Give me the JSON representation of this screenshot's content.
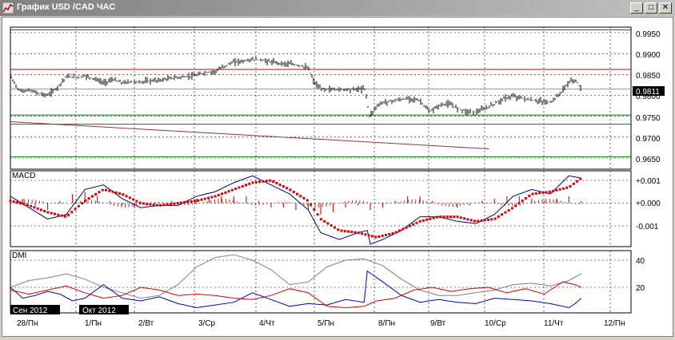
{
  "window": {
    "title": "График USD /CAD  ЧАС",
    "btn_minimize": "_",
    "btn_maximize": "□",
    "btn_close": "✕"
  },
  "colors": {
    "price_bars": "#000000",
    "resistance_red": "#cc0000",
    "support_green": "#008000",
    "trend_line": "#993333",
    "macd_line": "#000080",
    "macd_signal": "#dd0000",
    "histogram": "#cc2222",
    "dmi_adx": "#808080",
    "dmi_plus": "#0000cc",
    "dmi_minus": "#dd0000",
    "price_tag_bg": "#000000"
  },
  "icons": {
    "title": "chart-app-icon"
  },
  "price_panel": {
    "y_ticks": [
      "0.9950",
      "0.9900",
      "0.9850",
      "0.9800",
      "0.9750",
      "0.9700",
      "0.9650"
    ],
    "current_price": "0.9811",
    "hlines_red": [
      0.9957,
      0.9862
    ],
    "hline_pink": 0.9815,
    "hlines_green": [
      0.9753,
      0.9731,
      0.9653
    ],
    "trend_line": [
      [
        0.9737,
        0
      ],
      [
        0.9672,
        0.771
      ]
    ],
    "series_points": [
      [
        0,
        0.9845
      ],
      [
        0.015,
        0.981
      ],
      [
        0.03,
        0.9812
      ],
      [
        0.045,
        0.9805
      ],
      [
        0.06,
        0.98
      ],
      [
        0.075,
        0.9818
      ],
      [
        0.09,
        0.9845
      ],
      [
        0.105,
        0.9843
      ],
      [
        0.12,
        0.9847
      ],
      [
        0.135,
        0.984
      ],
      [
        0.15,
        0.983
      ],
      [
        0.165,
        0.9838
      ],
      [
        0.18,
        0.983
      ],
      [
        0.195,
        0.9833
      ],
      [
        0.21,
        0.9832
      ],
      [
        0.225,
        0.9835
      ],
      [
        0.24,
        0.9836
      ],
      [
        0.255,
        0.984
      ],
      [
        0.27,
        0.9843
      ],
      [
        0.285,
        0.9845
      ],
      [
        0.3,
        0.9848
      ],
      [
        0.315,
        0.9855
      ],
      [
        0.33,
        0.9857
      ],
      [
        0.345,
        0.987
      ],
      [
        0.36,
        0.988
      ],
      [
        0.375,
        0.9882
      ],
      [
        0.39,
        0.9886
      ],
      [
        0.405,
        0.9885
      ],
      [
        0.42,
        0.988
      ],
      [
        0.435,
        0.9877
      ],
      [
        0.45,
        0.9875
      ],
      [
        0.465,
        0.9872
      ],
      [
        0.48,
        0.9865
      ],
      [
        0.49,
        0.983
      ],
      [
        0.5,
        0.9815
      ],
      [
        0.515,
        0.9815
      ],
      [
        0.53,
        0.9814
      ],
      [
        0.545,
        0.9815
      ],
      [
        0.56,
        0.9815
      ],
      [
        0.572,
        0.9816
      ],
      [
        0.578,
        0.975
      ],
      [
        0.59,
        0.9774
      ],
      [
        0.6,
        0.9783
      ],
      [
        0.615,
        0.9787
      ],
      [
        0.63,
        0.979
      ],
      [
        0.645,
        0.9793
      ],
      [
        0.66,
        0.9787
      ],
      [
        0.675,
        0.976
      ],
      [
        0.69,
        0.9775
      ],
      [
        0.705,
        0.978
      ],
      [
        0.72,
        0.977
      ],
      [
        0.735,
        0.9762
      ],
      [
        0.75,
        0.976
      ],
      [
        0.765,
        0.9768
      ],
      [
        0.78,
        0.978
      ],
      [
        0.795,
        0.9792
      ],
      [
        0.81,
        0.9798
      ],
      [
        0.825,
        0.9793
      ],
      [
        0.84,
        0.9788
      ],
      [
        0.855,
        0.9786
      ],
      [
        0.87,
        0.9783
      ],
      [
        0.885,
        0.9803
      ],
      [
        0.9,
        0.9832
      ],
      [
        0.91,
        0.9837
      ],
      [
        0.92,
        0.9815
      ]
    ]
  },
  "macd_panel": {
    "label": "MACD",
    "y_ticks": [
      "+0.001",
      "+0.000",
      "-0.001"
    ],
    "macd_line": [
      [
        0,
        0.0003
      ],
      [
        0.03,
        -0.0002
      ],
      [
        0.06,
        -0.0007
      ],
      [
        0.09,
        -0.0005
      ],
      [
        0.12,
        0.0006
      ],
      [
        0.15,
        0.0008
      ],
      [
        0.18,
        0.0002
      ],
      [
        0.21,
        -0.0002
      ],
      [
        0.24,
        -0.0001
      ],
      [
        0.27,
        -0.0001
      ],
      [
        0.3,
        0.0003
      ],
      [
        0.33,
        0.0005
      ],
      [
        0.36,
        0.0009
      ],
      [
        0.39,
        0.0012
      ],
      [
        0.42,
        0.0008
      ],
      [
        0.45,
        0.0004
      ],
      [
        0.48,
        -0.0003
      ],
      [
        0.5,
        -0.0013
      ],
      [
        0.53,
        -0.0016
      ],
      [
        0.56,
        -0.0013
      ],
      [
        0.575,
        -0.0012
      ],
      [
        0.58,
        -0.0018
      ],
      [
        0.6,
        -0.0016
      ],
      [
        0.63,
        -0.0012
      ],
      [
        0.66,
        -0.0006
      ],
      [
        0.69,
        -0.0006
      ],
      [
        0.72,
        -0.0008
      ],
      [
        0.75,
        -0.0009
      ],
      [
        0.78,
        -0.0005
      ],
      [
        0.81,
        0.0003
      ],
      [
        0.84,
        0.0006
      ],
      [
        0.87,
        0.0004
      ],
      [
        0.9,
        0.0012
      ],
      [
        0.92,
        0.0011
      ]
    ],
    "signal_line": [
      [
        0,
        0.0001
      ],
      [
        0.03,
        -0.0001
      ],
      [
        0.06,
        -0.0004
      ],
      [
        0.09,
        -0.0006
      ],
      [
        0.12,
        0.0001
      ],
      [
        0.15,
        0.0006
      ],
      [
        0.18,
        0.0004
      ],
      [
        0.21,
        0.0
      ],
      [
        0.24,
        -0.0001
      ],
      [
        0.27,
        0.0
      ],
      [
        0.3,
        0.0001
      ],
      [
        0.33,
        0.0003
      ],
      [
        0.36,
        0.0006
      ],
      [
        0.39,
        0.0009
      ],
      [
        0.42,
        0.001
      ],
      [
        0.45,
        0.0006
      ],
      [
        0.48,
        0.0001
      ],
      [
        0.5,
        -0.0007
      ],
      [
        0.53,
        -0.0012
      ],
      [
        0.56,
        -0.0013
      ],
      [
        0.59,
        -0.0015
      ],
      [
        0.62,
        -0.0013
      ],
      [
        0.66,
        -0.0008
      ],
      [
        0.69,
        -0.0006
      ],
      [
        0.72,
        -0.0006
      ],
      [
        0.75,
        -0.0008
      ],
      [
        0.78,
        -0.0007
      ],
      [
        0.81,
        -0.0002
      ],
      [
        0.84,
        0.0004
      ],
      [
        0.87,
        0.0005
      ],
      [
        0.9,
        0.0007
      ],
      [
        0.92,
        0.0011
      ]
    ],
    "histogram": [
      [
        0.02,
        0.0002
      ],
      [
        0.04,
        -0.0001
      ],
      [
        0.06,
        -0.0003
      ],
      [
        0.08,
        0.0001
      ],
      [
        0.1,
        0.0004
      ],
      [
        0.12,
        0.0005
      ],
      [
        0.14,
        0.0003
      ],
      [
        0.16,
        0.0001
      ],
      [
        0.18,
        -0.0001
      ],
      [
        0.2,
        -0.0002
      ],
      [
        0.22,
        -0.0001
      ],
      [
        0.24,
        0.0
      ],
      [
        0.26,
        0.0001
      ],
      [
        0.28,
        0.0001
      ],
      [
        0.3,
        0.0002
      ],
      [
        0.32,
        0.0002
      ],
      [
        0.34,
        0.0003
      ],
      [
        0.36,
        0.0003
      ],
      [
        0.38,
        0.0003
      ],
      [
        0.4,
        0.0001
      ],
      [
        0.42,
        -0.0002
      ],
      [
        0.44,
        -0.0002
      ],
      [
        0.46,
        -0.0003
      ],
      [
        0.48,
        -0.0003
      ],
      [
        0.5,
        -0.0005
      ],
      [
        0.52,
        -0.0004
      ],
      [
        0.54,
        -0.0002
      ],
      [
        0.56,
        -0.0001
      ],
      [
        0.58,
        -0.0003
      ],
      [
        0.6,
        -0.0002
      ],
      [
        0.62,
        0.0001
      ],
      [
        0.64,
        0.0003
      ],
      [
        0.66,
        0.0003
      ],
      [
        0.68,
        0.0001
      ],
      [
        0.7,
        0.0
      ],
      [
        0.72,
        -0.0002
      ],
      [
        0.74,
        -0.0001
      ],
      [
        0.76,
        0.0001
      ],
      [
        0.78,
        0.0002
      ],
      [
        0.8,
        0.0003
      ],
      [
        0.82,
        0.0003
      ],
      [
        0.84,
        0.0002
      ],
      [
        0.86,
        0.0001
      ],
      [
        0.88,
        0.0002
      ],
      [
        0.9,
        0.0003
      ],
      [
        0.92,
        0.0001
      ]
    ]
  },
  "dmi_panel": {
    "label": "DMI",
    "y_ticks": [
      "40",
      "20"
    ],
    "adx": [
      [
        0,
        20
      ],
      [
        0.03,
        25
      ],
      [
        0.06,
        27
      ],
      [
        0.09,
        30
      ],
      [
        0.12,
        26
      ],
      [
        0.15,
        20
      ],
      [
        0.18,
        16
      ],
      [
        0.21,
        12
      ],
      [
        0.24,
        14
      ],
      [
        0.27,
        22
      ],
      [
        0.3,
        35
      ],
      [
        0.33,
        42
      ],
      [
        0.36,
        44
      ],
      [
        0.39,
        40
      ],
      [
        0.42,
        33
      ],
      [
        0.45,
        22
      ],
      [
        0.48,
        24
      ],
      [
        0.51,
        35
      ],
      [
        0.54,
        40
      ],
      [
        0.57,
        41
      ],
      [
        0.6,
        36
      ],
      [
        0.63,
        26
      ],
      [
        0.66,
        18
      ],
      [
        0.69,
        14
      ],
      [
        0.72,
        14
      ],
      [
        0.75,
        16
      ],
      [
        0.78,
        18
      ],
      [
        0.81,
        22
      ],
      [
        0.84,
        23
      ],
      [
        0.87,
        21
      ],
      [
        0.9,
        25
      ],
      [
        0.92,
        30
      ]
    ],
    "plus_di": [
      [
        0,
        20
      ],
      [
        0.02,
        12
      ],
      [
        0.04,
        14
      ],
      [
        0.06,
        17
      ],
      [
        0.08,
        15
      ],
      [
        0.1,
        10
      ],
      [
        0.12,
        12
      ],
      [
        0.15,
        22
      ],
      [
        0.18,
        12
      ],
      [
        0.21,
        10
      ],
      [
        0.24,
        13
      ],
      [
        0.27,
        8
      ],
      [
        0.3,
        5
      ],
      [
        0.33,
        7
      ],
      [
        0.36,
        9
      ],
      [
        0.39,
        16
      ],
      [
        0.42,
        11
      ],
      [
        0.45,
        6
      ],
      [
        0.48,
        8
      ],
      [
        0.51,
        7
      ],
      [
        0.54,
        11
      ],
      [
        0.57,
        9
      ],
      [
        0.575,
        32
      ],
      [
        0.6,
        24
      ],
      [
        0.63,
        14
      ],
      [
        0.66,
        9
      ],
      [
        0.69,
        11
      ],
      [
        0.72,
        9
      ],
      [
        0.75,
        8
      ],
      [
        0.78,
        12
      ],
      [
        0.81,
        11
      ],
      [
        0.84,
        10
      ],
      [
        0.87,
        8
      ],
      [
        0.9,
        5
      ],
      [
        0.91,
        8
      ],
      [
        0.92,
        12
      ]
    ],
    "minus_di": [
      [
        0,
        18
      ],
      [
        0.03,
        15
      ],
      [
        0.06,
        18
      ],
      [
        0.09,
        21
      ],
      [
        0.12,
        16
      ],
      [
        0.15,
        12
      ],
      [
        0.18,
        14
      ],
      [
        0.21,
        20
      ],
      [
        0.24,
        18
      ],
      [
        0.27,
        14
      ],
      [
        0.3,
        15
      ],
      [
        0.33,
        14
      ],
      [
        0.36,
        12
      ],
      [
        0.39,
        11
      ],
      [
        0.42,
        14
      ],
      [
        0.45,
        19
      ],
      [
        0.48,
        16
      ],
      [
        0.51,
        6
      ],
      [
        0.54,
        5
      ],
      [
        0.57,
        6
      ],
      [
        0.59,
        10
      ],
      [
        0.62,
        12
      ],
      [
        0.65,
        18
      ],
      [
        0.68,
        20
      ],
      [
        0.71,
        17
      ],
      [
        0.74,
        19
      ],
      [
        0.77,
        20
      ],
      [
        0.8,
        16
      ],
      [
        0.83,
        19
      ],
      [
        0.86,
        15
      ],
      [
        0.89,
        24
      ],
      [
        0.91,
        22
      ],
      [
        0.92,
        20
      ]
    ]
  },
  "time_axis": {
    "labels": [
      "28/Пн",
      "1/Пн",
      "2/Вт",
      "3/Ср",
      "4/Чт",
      "5/Пн",
      "8/Пн",
      "9/Вт",
      "10/Ср",
      "11/Чт",
      "12/Пн"
    ],
    "month_labels": [
      "Сен 2012",
      "Окт 2012"
    ]
  }
}
